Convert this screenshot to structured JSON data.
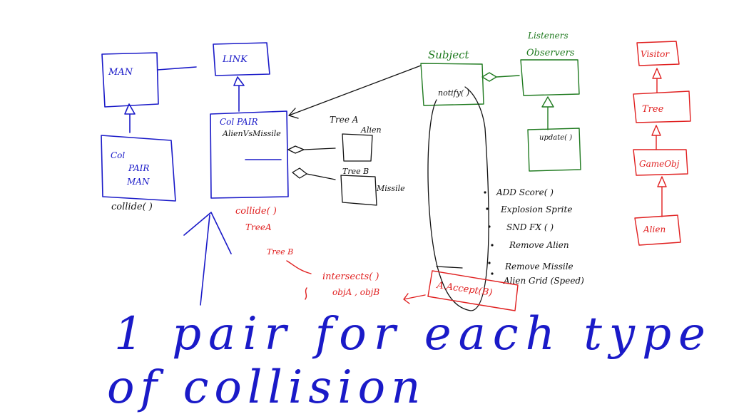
{
  "blue": {
    "man": "MAN",
    "link": "LINK",
    "col_pair_man_1": "Col",
    "col_pair_man_2": "PAIR",
    "col_pair_man_3": "MAN",
    "collide": "collide( )",
    "col_pair_1": "Col PAIR",
    "col_pair_2": "AlienVsMissile",
    "big_text_line1": "1 pair for each type",
    "big_text_line2": "of collision"
  },
  "black": {
    "tree_a": "Tree A",
    "alien": "Alien",
    "tree_b": "Tree B",
    "missile": "Missile",
    "notify": "notify( )",
    "update": "update( )",
    "list": [
      "ADD Score( )",
      "Explosion Sprite",
      "SND FX ( )",
      "Remove Alien",
      "Remove Missile",
      "Alien Grid (Speed)"
    ]
  },
  "red": {
    "collide": "collide( )",
    "tree_a": "TreeA",
    "tree_b": "Tree B",
    "intersect": "intersects( )",
    "objs": "objA , objB",
    "accept": "A.Accept(B)",
    "visitor": "Visitor",
    "tree": "Tree",
    "gameobj": "GameObj",
    "alien": "Alien"
  },
  "green": {
    "subject": "Subject",
    "listeners": "Listeners",
    "observers": "Observers"
  },
  "colors": {
    "blue": "#1a1ac8",
    "red": "#e02020",
    "green": "#1f7a1f",
    "black": "#111111"
  }
}
